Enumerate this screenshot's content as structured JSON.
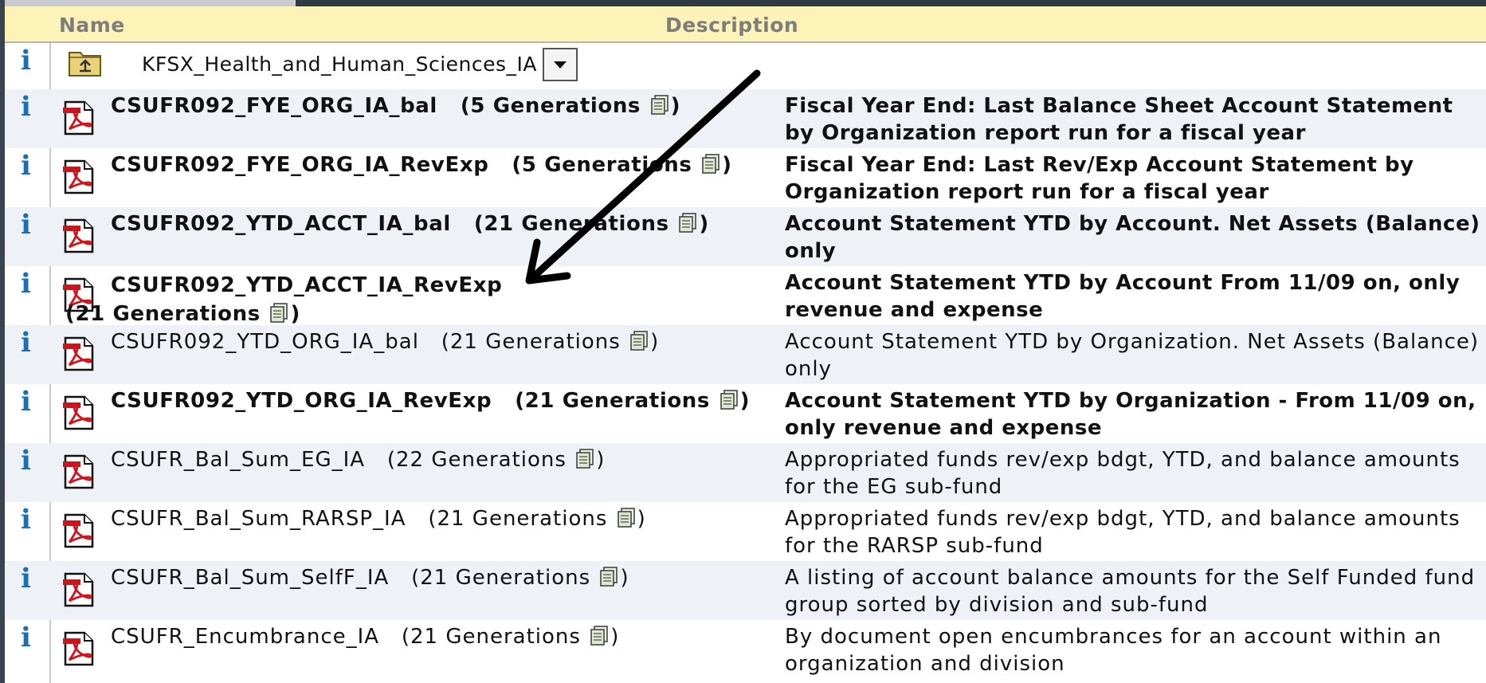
{
  "header": {
    "name_label": "Name",
    "description_label": "Description"
  },
  "info_glyph": "i",
  "folder": {
    "name": "KFSX_Health_and_Human_Sciences_IA",
    "icon": "folder-up-icon"
  },
  "rows": [
    {
      "name": "CSUFR092_FYE_ORG_IA_bal",
      "generations": "(5 Generations",
      "close": ")",
      "description": "Fiscal Year End: Last Balance Sheet Account Statement by Organization report run for a fiscal year",
      "bold": true
    },
    {
      "name": "CSUFR092_FYE_ORG_IA_RevExp",
      "generations": "(5 Generations",
      "close": ")",
      "description": "Fiscal Year End: Last Rev/Exp Account Statement by Organization report run for a fiscal year",
      "bold": true
    },
    {
      "name": "CSUFR092_YTD_ACCT_IA_bal",
      "generations": "(21 Generations",
      "close": ")",
      "description": "Account Statement YTD by Account. Net Assets (Balance) only",
      "bold": true
    },
    {
      "name": "CSUFR092_YTD_ACCT_IA_RevExp",
      "generations": "(21 Generations",
      "close": ")",
      "description": "Account Statement YTD by Account From 11/09 on, only revenue and expense",
      "bold": true
    },
    {
      "name": "CSUFR092_YTD_ORG_IA_bal",
      "generations": "(21 Generations",
      "close": ")",
      "description": "Account Statement YTD by Organization. Net Assets (Balance) only",
      "bold": false
    },
    {
      "name": "CSUFR092_YTD_ORG_IA_RevExp",
      "generations": "(21 Generations",
      "close": ")",
      "description": "Account Statement YTD by Organization - From 11/09 on, only revenue and expense",
      "bold": true
    },
    {
      "name": "CSUFR_Bal_Sum_EG_IA",
      "generations": "(22 Generations",
      "close": ")",
      "description": "Appropriated funds rev/exp bdgt, YTD, and balance amounts for the EG sub-fund",
      "bold": false
    },
    {
      "name": "CSUFR_Bal_Sum_RARSP_IA",
      "generations": "(21 Generations",
      "close": ")",
      "description": "Appropriated funds rev/exp bdgt, YTD, and balance amounts for the RARSP sub-fund",
      "bold": false
    },
    {
      "name": "CSUFR_Bal_Sum_SelfF_IA",
      "generations": "(21 Generations",
      "close": ")",
      "description": "A listing of account balance amounts for the Self Funded fund group sorted by division and sub-fund",
      "bold": false
    },
    {
      "name": "CSUFR_Encumbrance_IA",
      "generations": "(21 Generations",
      "close": ")",
      "description": "By document open encumbrances for an account within an organization and division",
      "bold": false
    }
  ],
  "icons": {
    "info": "info-icon",
    "report": "pdf-report-icon",
    "generations": "copies-icon",
    "dropdown": "chevron-down-icon"
  },
  "colors": {
    "header_bg": "#fdf3b8",
    "row_alt": "#eef1f6",
    "info": "#1d6fb5",
    "pdf_red": "#d0121b"
  }
}
